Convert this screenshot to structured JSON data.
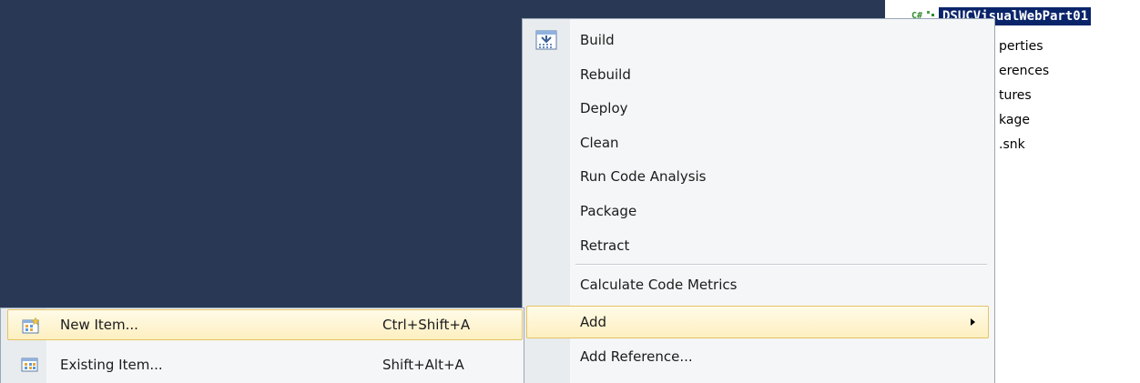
{
  "solution_explorer": {
    "project_name": "DSUCVisualWebPart01",
    "items": [
      "perties",
      "erences",
      "tures",
      "kage",
      ".snk"
    ]
  },
  "context_menu": {
    "items": [
      {
        "label": "Build",
        "icon": "build-icon"
      },
      {
        "label": "Rebuild"
      },
      {
        "label": "Deploy"
      },
      {
        "label": "Clean"
      },
      {
        "label": "Run Code Analysis"
      },
      {
        "label": "Package"
      },
      {
        "label": "Retract"
      },
      {
        "label": "Calculate Code Metrics"
      },
      {
        "label": "Add",
        "has_submenu": true,
        "highlighted": true
      },
      {
        "label": "Add Reference..."
      }
    ]
  },
  "add_submenu": {
    "items": [
      {
        "label": "New Item...",
        "shortcut": "Ctrl+Shift+A",
        "icon": "new-item-icon",
        "highlighted": true
      },
      {
        "label": "Existing Item...",
        "shortcut": "Shift+Alt+A",
        "icon": "existing-item-icon"
      }
    ]
  },
  "colors": {
    "editor_background": "#293955",
    "highlight_border": "#e5c365",
    "selection": "#0a246a"
  }
}
